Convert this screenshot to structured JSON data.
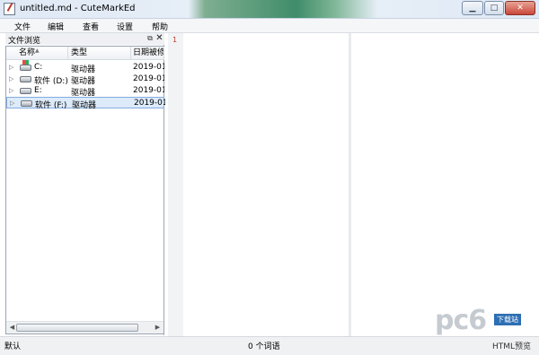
{
  "window": {
    "title": "untitled.md - CuteMarkEd"
  },
  "menu": [
    "文件",
    "编辑",
    "查看",
    "设置",
    "帮助"
  ],
  "file_browser": {
    "title": "文件浏览",
    "columns": [
      "名称",
      "类型",
      "日期被修"
    ],
    "rows": [
      {
        "name": "C:",
        "type": "驱动器",
        "date": "2019-01-"
      },
      {
        "name": "软件 (D:)",
        "type": "驱动器",
        "date": "2019-01-"
      },
      {
        "name": "E:",
        "type": "驱动器",
        "date": "2019-01-"
      },
      {
        "name": "软件 (F:)",
        "type": "驱动器",
        "date": "2019-01-"
      }
    ]
  },
  "editor": {
    "line_number": "1"
  },
  "status": {
    "left": "默认",
    "center": "0 个词语",
    "right": "HTML预览"
  },
  "watermark": {
    "text": "pc6",
    "badge": "下载站"
  }
}
